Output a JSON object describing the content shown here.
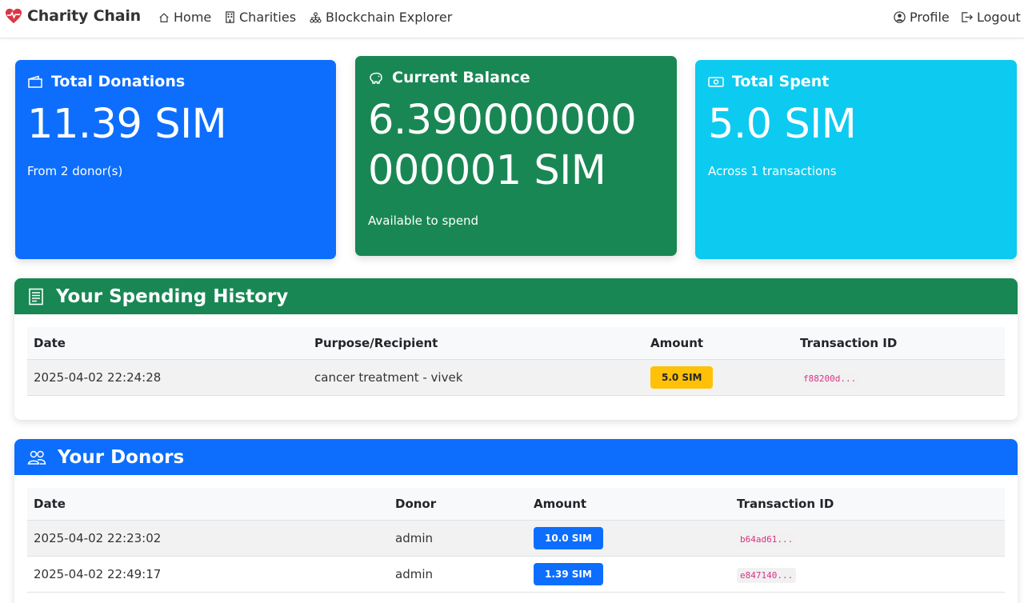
{
  "navbar": {
    "brand": "Charity Chain",
    "links": [
      {
        "label": "Home",
        "icon": "home-icon"
      },
      {
        "label": "Charities",
        "icon": "building-icon"
      },
      {
        "label": "Blockchain Explorer",
        "icon": "diagram-icon"
      }
    ],
    "profile": "Profile",
    "logout": "Logout"
  },
  "cards": {
    "donations": {
      "title": "Total Donations",
      "value": "11.39 SIM",
      "sub": "From 2 donor(s)",
      "color": "#0d6efd"
    },
    "balance": {
      "title": "Current Balance",
      "value_line1": "6.390000000",
      "value_line2": "000001 SIM",
      "sub": "Available to spend",
      "color": "#198754"
    },
    "spent": {
      "title": "Total Spent",
      "value": "5.0 SIM",
      "sub": "Across 1 transactions",
      "color": "#0dcaf0"
    }
  },
  "spending": {
    "title": "Your Spending History",
    "color": "#198754",
    "headers": [
      "Date",
      "Purpose/Recipient",
      "Amount",
      "Transaction ID"
    ],
    "rows": [
      {
        "date": "2025-04-02 22:24:28",
        "purpose": "cancer treatment - vivek",
        "amount": "5.0 SIM",
        "tx": "f88200d..."
      }
    ],
    "badge_color": "#ffc107"
  },
  "donors": {
    "title": "Your Donors",
    "color": "#0d6efd",
    "headers": [
      "Date",
      "Donor",
      "Amount",
      "Transaction ID"
    ],
    "rows": [
      {
        "date": "2025-04-02 22:23:02",
        "donor": "admin",
        "amount": "10.0 SIM",
        "tx": "b64ad61..."
      },
      {
        "date": "2025-04-02 22:49:17",
        "donor": "admin",
        "amount": "1.39 SIM",
        "tx": "e847140..."
      }
    ]
  }
}
